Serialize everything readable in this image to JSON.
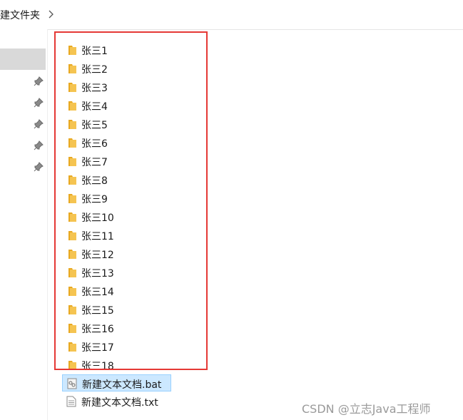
{
  "breadcrumb": {
    "current": "建文件夹"
  },
  "icons": {
    "folder": "folder-icon",
    "pin": "pin-icon",
    "chevron": "chevron-right-icon",
    "bat_file": "batch-file-icon",
    "txt_file": "text-file-icon"
  },
  "colors": {
    "folder": "#f5c451",
    "highlight_border": "#e53935",
    "selection": "#cce8ff",
    "nav_selected": "#d9d9d9"
  },
  "folders": [
    {
      "label": "张三1"
    },
    {
      "label": "张三2"
    },
    {
      "label": "张三3"
    },
    {
      "label": "张三4"
    },
    {
      "label": "张三5"
    },
    {
      "label": "张三6"
    },
    {
      "label": "张三7"
    },
    {
      "label": "张三8"
    },
    {
      "label": "张三9"
    },
    {
      "label": "张三10"
    },
    {
      "label": "张三11"
    },
    {
      "label": "张三12"
    },
    {
      "label": "张三13"
    },
    {
      "label": "张三14"
    },
    {
      "label": "张三15"
    },
    {
      "label": "张三16"
    },
    {
      "label": "张三17"
    },
    {
      "label": "张三18"
    }
  ],
  "files": [
    {
      "label": "新建文本文档.bat",
      "selected": true
    },
    {
      "label": "新建文本文档.txt",
      "selected": false
    }
  ],
  "watermark": "CSDN @立志Java工程师"
}
